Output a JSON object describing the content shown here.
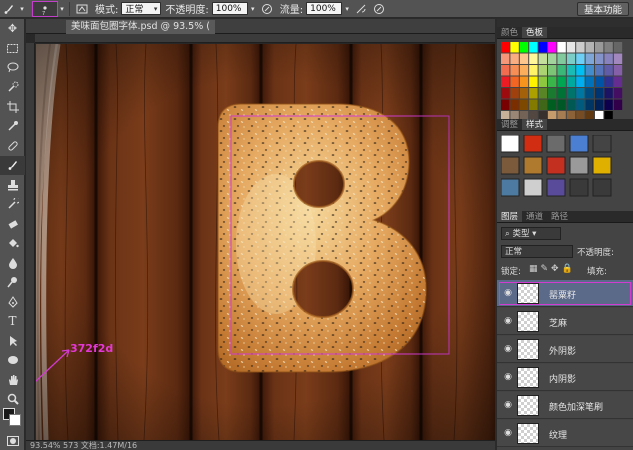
{
  "options_bar": {
    "mode_label": "模式:",
    "mode_value": "正常",
    "opacity_label": "不透明度:",
    "opacity_value": "100%",
    "flow_label": "流量:",
    "flow_value": "100%",
    "workspace_label": "基本功能"
  },
  "document": {
    "tab_title": "美味面包圈字体.psd @ 93.5% (",
    "status": "93.54%  573  文档:1.47M/16"
  },
  "panels": {
    "top_tabs": [
      "颜色",
      "色板"
    ],
    "mid_tabs": [
      "调整",
      "样式"
    ],
    "layer_tabs": [
      "图层",
      "通道",
      "路径"
    ],
    "filter_kind": "类型",
    "blend_mode": "正常",
    "opacity_label": "不透明度:",
    "lock_label": "锁定:",
    "fill_label": "填充:"
  },
  "layers": [
    {
      "name": "罂粟籽",
      "selected": true
    },
    {
      "name": "芝麻",
      "selected": false
    },
    {
      "name": "外阴影",
      "selected": false
    },
    {
      "name": "内阴影",
      "selected": false
    },
    {
      "name": "颜色加深笔刷",
      "selected": false
    },
    {
      "name": "纹理",
      "selected": false
    }
  ],
  "annotation": {
    "color_code": "372f2d"
  },
  "colors": {
    "accent": "#d23bd0",
    "wood_dark": "#3e1a0b",
    "wood_mid": "#6a3316",
    "bagel": "#e0a259"
  }
}
